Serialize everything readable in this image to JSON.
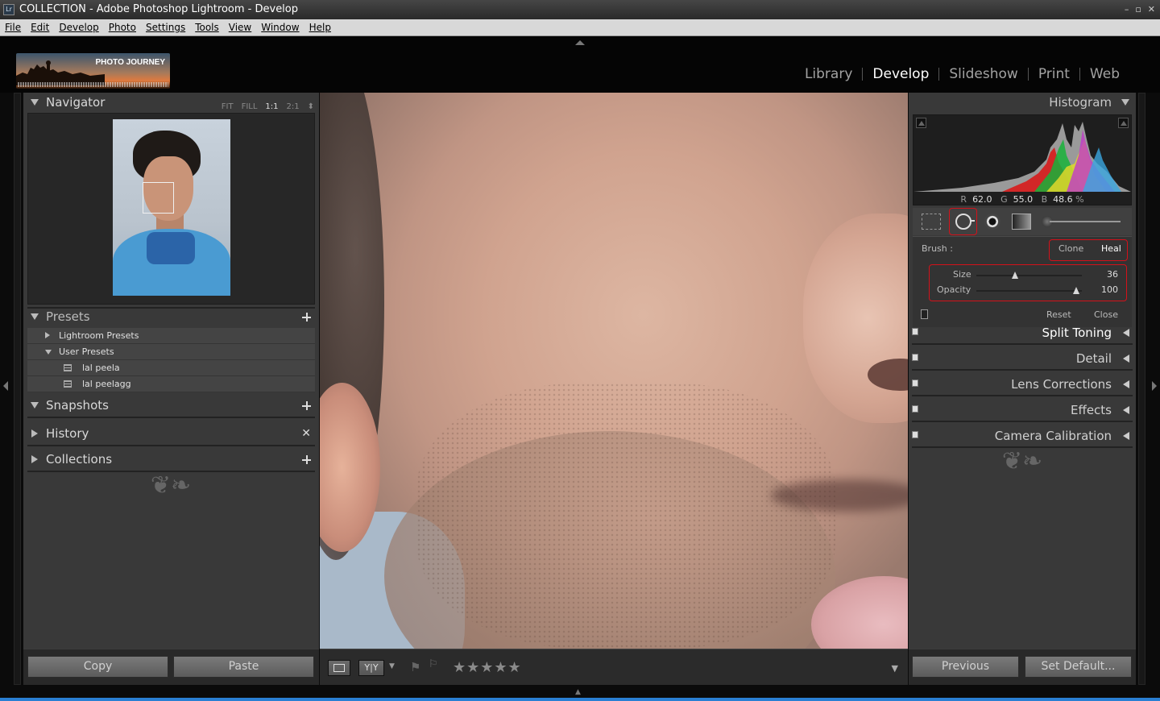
{
  "window": {
    "title": "COLLECTION - Adobe Photoshop Lightroom - Develop",
    "app_icon": "Lr",
    "controls": [
      "–",
      "▫",
      "✕"
    ]
  },
  "menu": [
    "File",
    "Edit",
    "Develop",
    "Photo",
    "Settings",
    "Tools",
    "View",
    "Window",
    "Help"
  ],
  "identity_plate": {
    "text": "PHOTO JOURNEY"
  },
  "modules": [
    {
      "label": "Library",
      "active": false
    },
    {
      "label": "Develop",
      "active": true
    },
    {
      "label": "Slideshow",
      "active": false
    },
    {
      "label": "Print",
      "active": false
    },
    {
      "label": "Web",
      "active": false
    }
  ],
  "navigator": {
    "title": "Navigator",
    "zoom_options": [
      "FIT",
      "FILL",
      "1:1",
      "2:1"
    ],
    "selected_zoom": "1:1",
    "zoom_stepper_icon": "up-down-stepper-icon"
  },
  "presets": {
    "title": "Presets",
    "items": [
      {
        "label": "Lightroom Presets",
        "level": 0,
        "expanded": false
      },
      {
        "label": "User Presets",
        "level": 0,
        "expanded": true
      },
      {
        "label": "lal peela",
        "level": 1
      },
      {
        "label": "lal peelagg",
        "level": 1
      }
    ]
  },
  "snapshots": {
    "title": "Snapshots"
  },
  "history": {
    "title": "History"
  },
  "collections": {
    "title": "Collections"
  },
  "left_buttons": {
    "copy": "Copy",
    "paste": "Paste"
  },
  "right_buttons": {
    "previous": "Previous",
    "set_default": "Set Default..."
  },
  "histogram": {
    "title": "Histogram",
    "readout": {
      "r_label": "R",
      "r": "62.0",
      "g_label": "G",
      "g": "55.0",
      "b_label": "B",
      "b": "48.6",
      "unit": "%"
    }
  },
  "spot_removal": {
    "brush_label": "Brush :",
    "modes": [
      "Clone",
      "Heal"
    ],
    "active_mode": "Heal",
    "size_label": "Size",
    "size_value": "36",
    "size_fraction": 0.37,
    "opacity_label": "Opacity",
    "opacity_value": "100",
    "opacity_fraction": 0.95,
    "reset": "Reset",
    "close": "Close"
  },
  "right_panels": [
    "Split Toning",
    "Detail",
    "Lens Corrections",
    "Effects",
    "Camera Calibration"
  ],
  "toolbar": {
    "stars": "★★★★★"
  },
  "colors": {
    "panel": "#393939",
    "accent_red": "#d4111a",
    "text": "#d0d0d0",
    "taskbar": "#2a7fd3"
  }
}
